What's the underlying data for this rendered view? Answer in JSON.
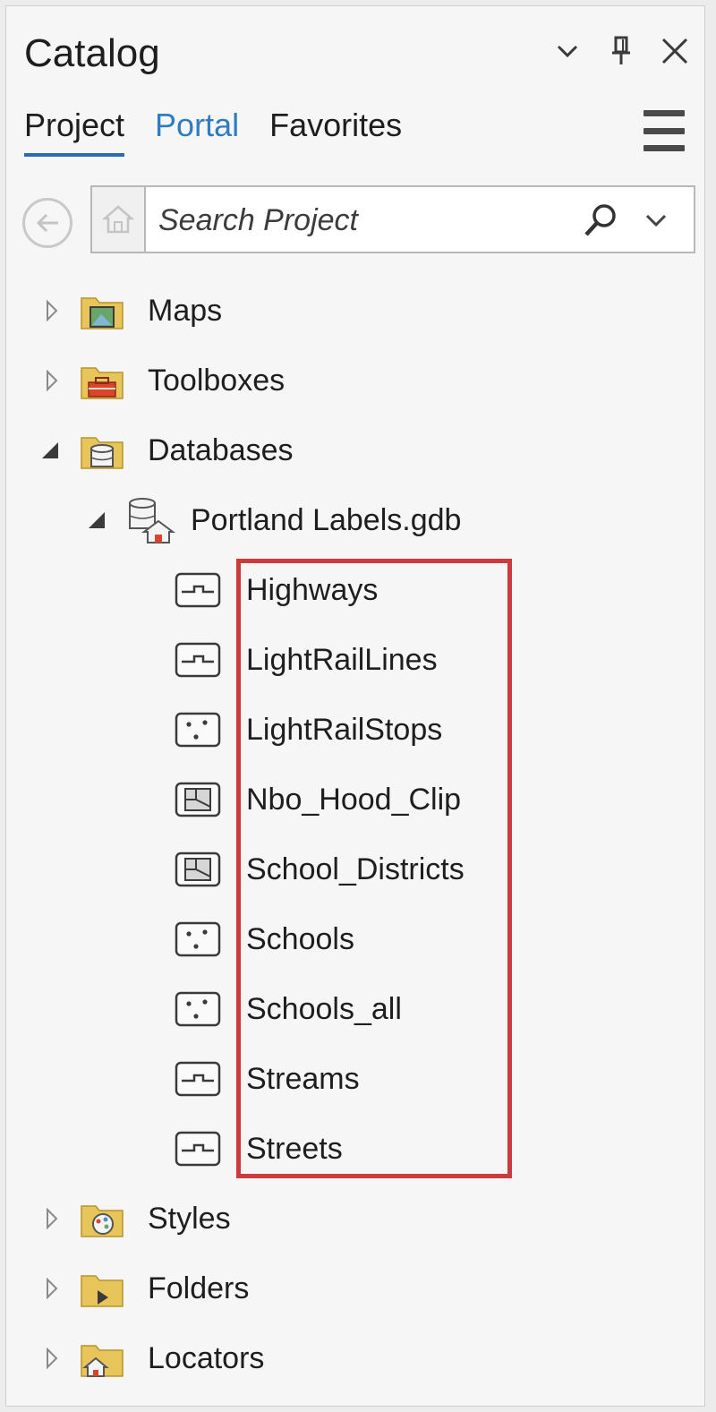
{
  "window": {
    "title": "Catalog",
    "controls": [
      "options-icon",
      "pin-icon",
      "close-icon"
    ]
  },
  "tabs": [
    {
      "label": "Project",
      "active": true
    },
    {
      "label": "Portal",
      "active": false
    },
    {
      "label": "Favorites",
      "active": false
    }
  ],
  "search": {
    "placeholder": "Search Project"
  },
  "colors": {
    "accent": "#2b6cb0",
    "portal_tab": "#2f7cc0",
    "highlight": "#cc3b3b",
    "folder": "#e8c55a"
  },
  "tree": {
    "maps": {
      "label": "Maps",
      "expanded": false,
      "icon": "maps-folder-icon"
    },
    "toolboxes": {
      "label": "Toolboxes",
      "expanded": false,
      "icon": "toolbox-folder-icon"
    },
    "databases": {
      "label": "Databases",
      "expanded": true,
      "icon": "database-folder-icon"
    },
    "gdb": {
      "label": "Portland Labels.gdb",
      "expanded": true,
      "icon": "home-geodatabase-icon"
    },
    "feature_classes": [
      {
        "label": "Highways",
        "icon": "line-feature-class-icon"
      },
      {
        "label": "LightRailLines",
        "icon": "line-feature-class-icon"
      },
      {
        "label": "LightRailStops",
        "icon": "point-feature-class-icon"
      },
      {
        "label": "Nbo_Hood_Clip",
        "icon": "polygon-feature-class-icon"
      },
      {
        "label": "School_Districts",
        "icon": "polygon-feature-class-icon"
      },
      {
        "label": "Schools",
        "icon": "point-feature-class-icon"
      },
      {
        "label": "Schools_all",
        "icon": "point-feature-class-icon"
      },
      {
        "label": "Streams",
        "icon": "line-feature-class-icon"
      },
      {
        "label": "Streets",
        "icon": "line-feature-class-icon"
      }
    ],
    "styles": {
      "label": "Styles",
      "expanded": false,
      "icon": "styles-folder-icon"
    },
    "folders": {
      "label": "Folders",
      "expanded": false,
      "icon": "folders-folder-icon"
    },
    "locators": {
      "label": "Locators",
      "expanded": false,
      "icon": "locators-folder-icon"
    }
  }
}
